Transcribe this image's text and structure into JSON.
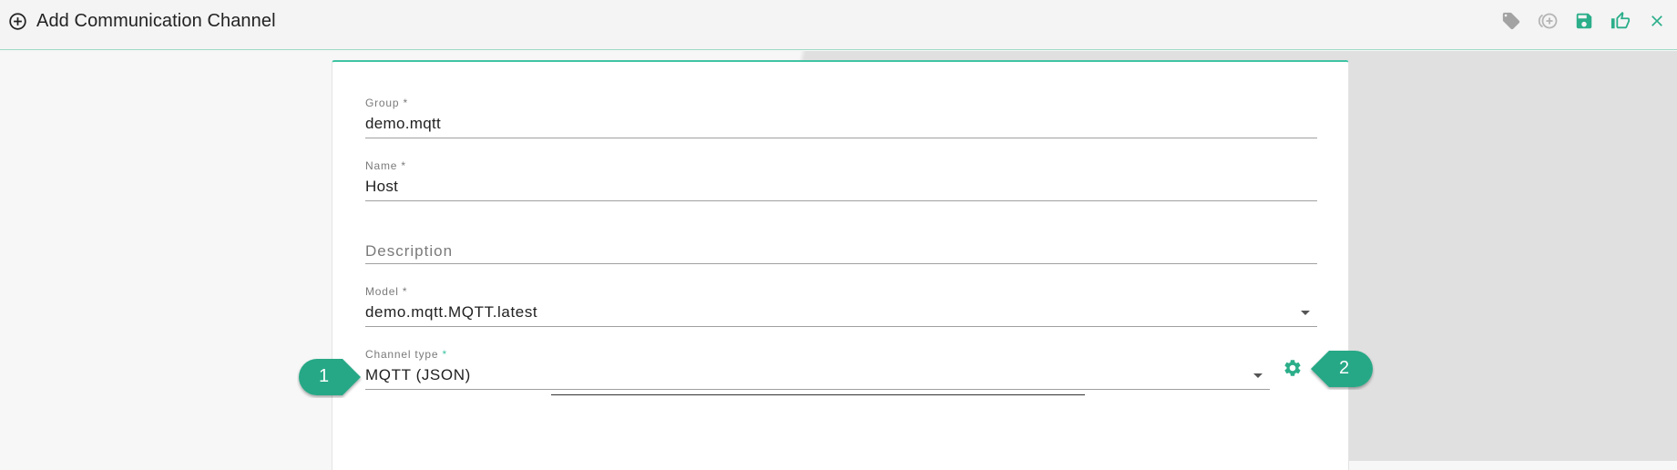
{
  "header": {
    "title": "Add Communication Channel",
    "title_icon": "add-circle-outline-icon",
    "actions": [
      {
        "name": "tag-icon",
        "color": "#9e9e9e"
      },
      {
        "name": "add-circle-copy-icon",
        "color": "#b0b0b0"
      },
      {
        "name": "save-icon",
        "color": "#2bae8a"
      },
      {
        "name": "thumbs-up-icon",
        "color": "#2bae8a"
      },
      {
        "name": "close-icon",
        "color": "#2bae8a"
      }
    ]
  },
  "form": {
    "group": {
      "label": "Group",
      "required_mark": "*",
      "value": "demo.mqtt"
    },
    "name": {
      "label": "Name",
      "required_mark": "*",
      "value": "Host"
    },
    "description": {
      "placeholder": "Description",
      "value": ""
    },
    "model": {
      "label": "Model",
      "required_mark": "*",
      "value": "demo.mqtt.MQTT.latest"
    },
    "channel_type": {
      "label": "Channel type",
      "required_mark": "*",
      "value": "MQTT (JSON)"
    },
    "settings_icon": "gear-icon"
  },
  "callouts": [
    {
      "number": "1"
    },
    {
      "number": "2"
    }
  ],
  "colors": {
    "accent": "#2bae8a",
    "callout": "#27a886",
    "accent_border": "#3fc4a4"
  }
}
